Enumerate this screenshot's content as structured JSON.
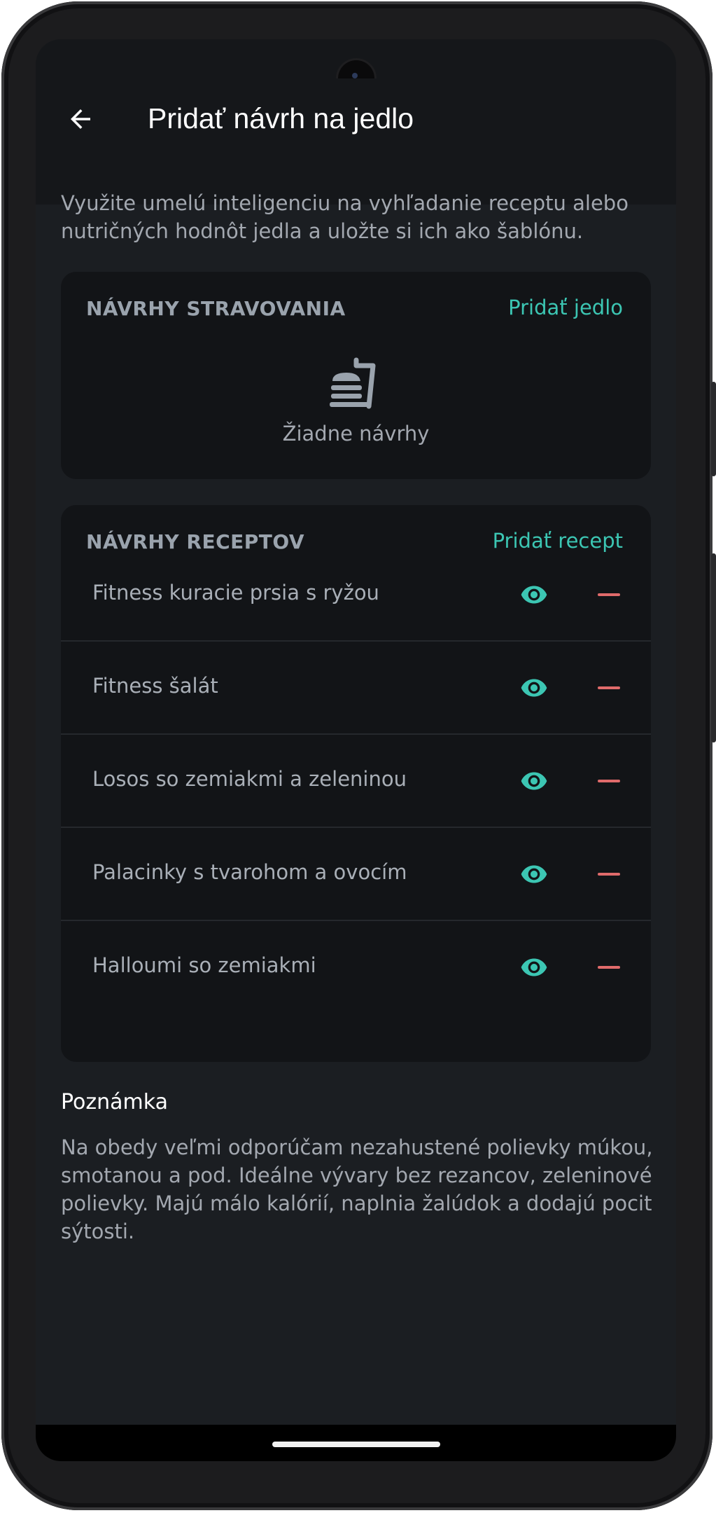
{
  "app_bar": {
    "title": "Pridať návrh na jedlo",
    "back_icon": "arrow-left-icon"
  },
  "intro": "Využite umelú inteligenciu na vyhľadanie receptu alebo nutričných hodnôt jedla a uložte si ich ako šablónu.",
  "meal_suggestions": {
    "header": "NÁVRHY STRAVOVANIA",
    "action": "Pridať jedlo",
    "empty_icon": "food-tray-icon",
    "empty_text": "Žiadne návrhy"
  },
  "recipe_suggestions": {
    "header": "NÁVRHY RECEPTOV",
    "action": "Pridať recept",
    "items": [
      {
        "name": "Fitness kuracie prsia s ryžou"
      },
      {
        "name": "Fitness šalát"
      },
      {
        "name": "Losos so zemiakmi a zeleninou"
      },
      {
        "name": "Palacinky s tvarohom a ovocím"
      },
      {
        "name": "Halloumi so zemiakmi"
      }
    ]
  },
  "note": {
    "title": "Poznámka",
    "text": "Na obedy veľmi odporúčam nezahustené polievky múkou, smotanou a pod. Ideálne vývary bez rezancov, zeleninové polievky. Majú málo kalórií, naplnia žalúdok a dodajú pocit sýtosti."
  },
  "colors": {
    "accent": "#3cc6b3",
    "danger": "#e06b6b",
    "background": "#1b1e22",
    "card": "#121417"
  }
}
